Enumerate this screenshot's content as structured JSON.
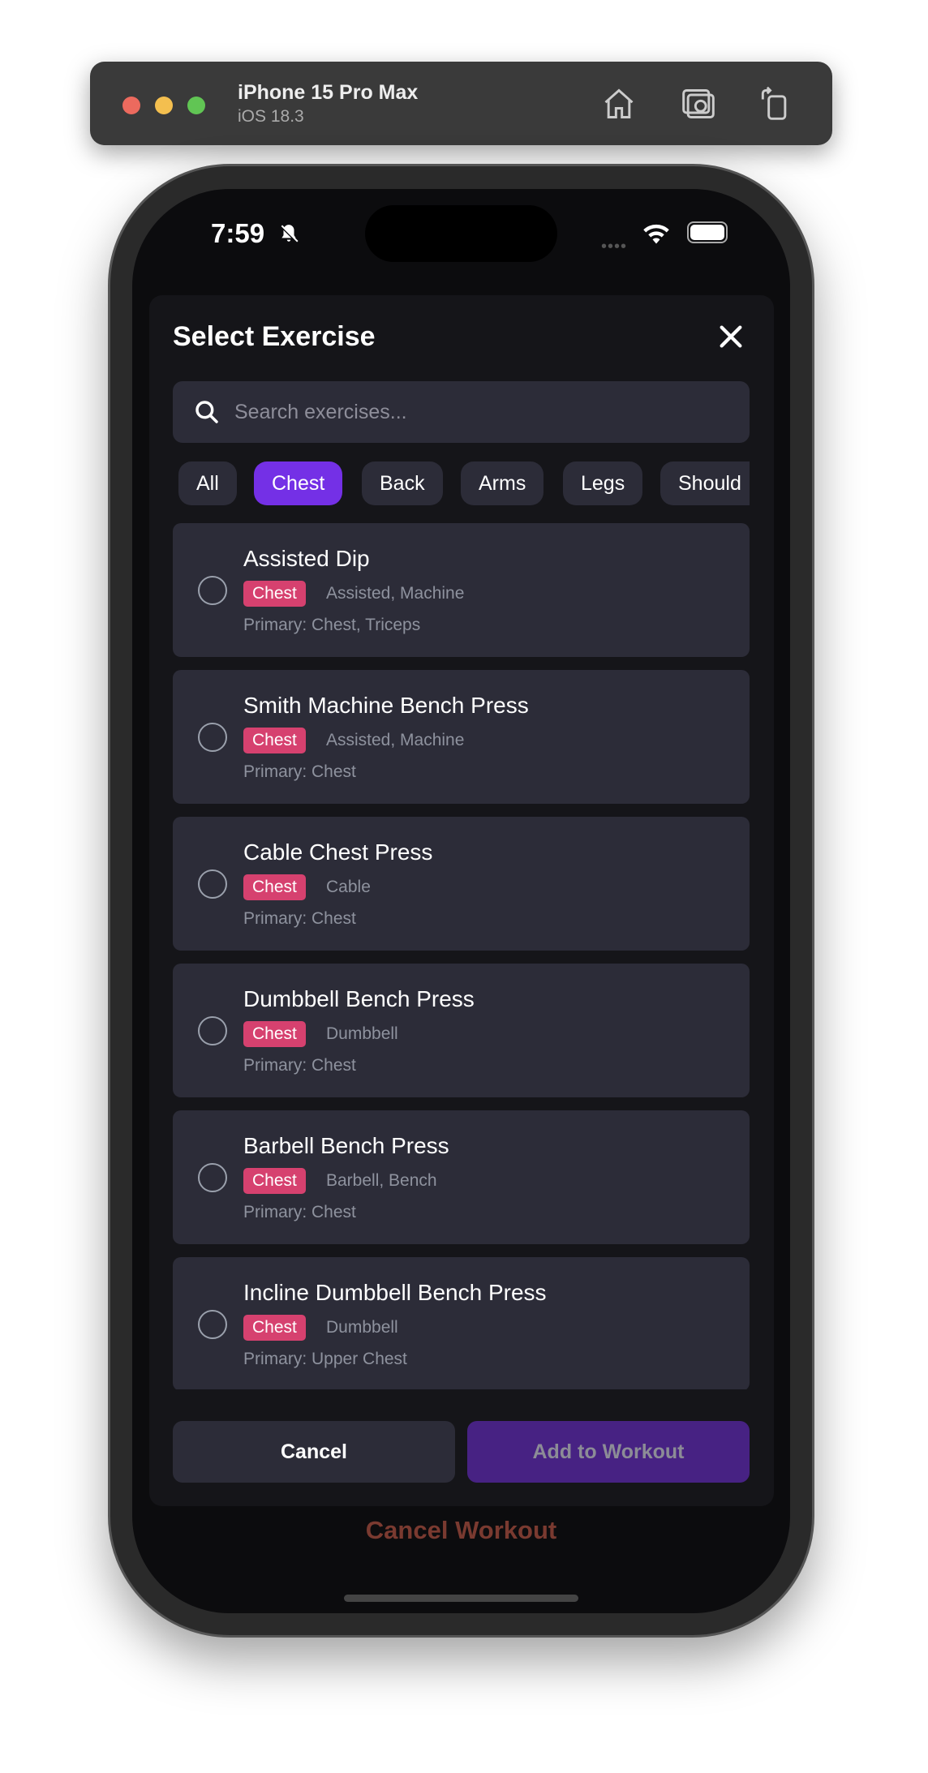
{
  "simulator": {
    "device": "iPhone 15 Pro Max",
    "os": "iOS 18.3"
  },
  "status": {
    "time": "7:59"
  },
  "modal": {
    "title": "Select Exercise",
    "search_placeholder": "Search exercises...",
    "filters": [
      {
        "label": "All"
      },
      {
        "label": "Chest",
        "active": true
      },
      {
        "label": "Back"
      },
      {
        "label": "Arms"
      },
      {
        "label": "Legs"
      },
      {
        "label": "Should"
      }
    ],
    "exercises": [
      {
        "name": "Assisted Dip",
        "badge": "Chest",
        "tags": "Assisted, Machine",
        "primary": "Primary: Chest, Triceps"
      },
      {
        "name": "Smith Machine Bench Press",
        "badge": "Chest",
        "tags": "Assisted, Machine",
        "primary": "Primary: Chest"
      },
      {
        "name": "Cable Chest Press",
        "badge": "Chest",
        "tags": "Cable",
        "primary": "Primary: Chest"
      },
      {
        "name": "Dumbbell Bench Press",
        "badge": "Chest",
        "tags": "Dumbbell",
        "primary": "Primary: Chest"
      },
      {
        "name": "Barbell Bench Press",
        "badge": "Chest",
        "tags": "Barbell, Bench",
        "primary": "Primary: Chest"
      },
      {
        "name": "Incline Dumbbell Bench Press",
        "badge": "Chest",
        "tags": "Dumbbell",
        "primary": "Primary: Upper Chest"
      }
    ],
    "cancel_label": "Cancel",
    "add_label": "Add to Workout"
  },
  "cancel_workout_label": "Cancel Workout",
  "colors": {
    "accent": "#7430e6",
    "badge": "#d6416f",
    "card": "#2c2c38"
  }
}
